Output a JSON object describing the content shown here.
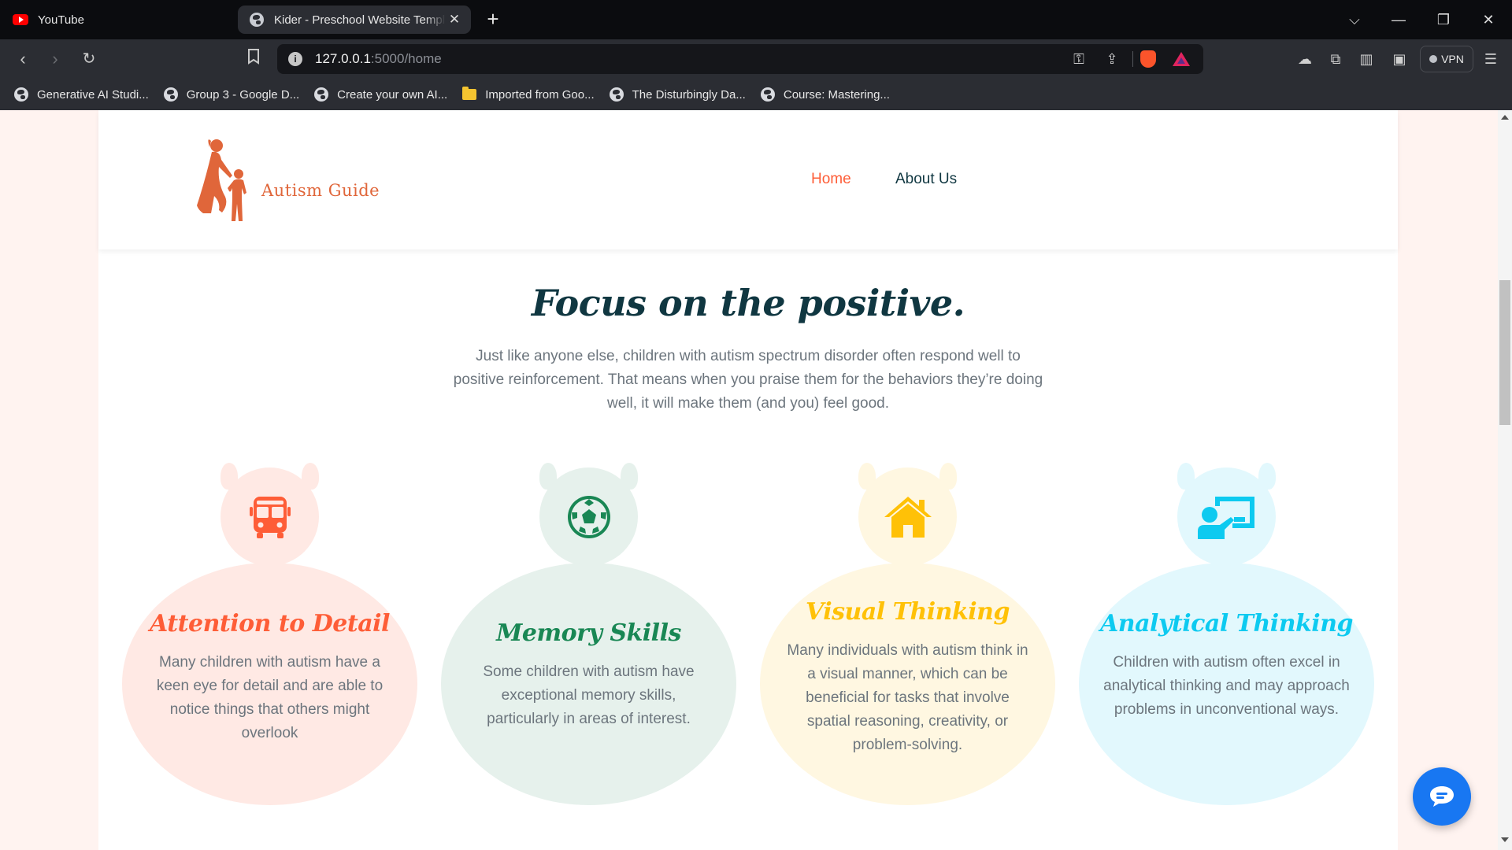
{
  "browser": {
    "tabs": [
      {
        "title": "YouTube",
        "favicon": "youtube-icon",
        "active": false
      },
      {
        "title": "Kider - Preschool Website Template",
        "favicon": "globe-icon",
        "active": true
      }
    ],
    "new_tab_label": "+",
    "address": {
      "host": "127.0.0.1",
      "path": ":5000/home"
    },
    "vpn_label": "VPN",
    "bookmarks": [
      {
        "label": "Generative AI Studi...",
        "icon": "globe-icon"
      },
      {
        "label": "Group 3 - Google D...",
        "icon": "globe-icon"
      },
      {
        "label": "Create your own AI...",
        "icon": "globe-icon"
      },
      {
        "label": "Imported from Goo...",
        "icon": "folder-icon"
      },
      {
        "label": "The Disturbingly Da...",
        "icon": "globe-icon"
      },
      {
        "label": "Course: Mastering...",
        "icon": "globe-icon"
      }
    ]
  },
  "site": {
    "brand": "Autism Guide",
    "nav": [
      {
        "label": "Home",
        "active": true
      },
      {
        "label": "About Us",
        "active": false
      }
    ],
    "heading": "Focus on the positive.",
    "intro": "Just like anyone else, children with autism spectrum disorder often respond well to positive reinforcement. That means when you praise them for the behaviors they’re doing well, it will make them (and you) feel good.",
    "cards": [
      {
        "title": "Attention to Detail",
        "text": "Many children with autism have a keen eye for detail and are able to notice things that others might overlook",
        "icon": "bus-icon",
        "color": "#fe5d37"
      },
      {
        "title": "Memory Skills",
        "text": "Some children with autism have exceptional memory skills, particularly in areas of interest.",
        "icon": "football-icon",
        "color": "#198754"
      },
      {
        "title": "Visual Thinking",
        "text": "Many individuals with autism think in a visual manner, which can be beneficial for tasks that involve spatial reasoning, creativity, or problem-solving.",
        "icon": "home-icon",
        "color": "#ffc107"
      },
      {
        "title": "Analytical Thinking",
        "text": "Children with autism often excel in analytical thinking and may approach problems in unconventional ways.",
        "icon": "chalkboard-teacher-icon",
        "color": "#0dcaf0"
      }
    ]
  },
  "colors": {
    "primary": "#fe5d37",
    "dark": "#103741",
    "muted": "#6c757d",
    "brand": "#e0663a"
  }
}
